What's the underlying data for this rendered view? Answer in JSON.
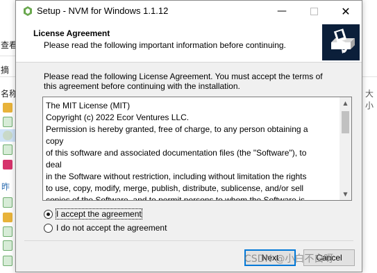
{
  "background": {
    "fragments": [
      "查看",
      "摘",
      "名称",
      "昨",
      "大小"
    ]
  },
  "window": {
    "title": "Setup - NVM for Windows 1.1.12",
    "minimize_glyph": "—",
    "close_glyph": "✕"
  },
  "header": {
    "title": "License Agreement",
    "subtitle": "Please read the following important information before continuing."
  },
  "intro": "Please read the following License Agreement. You must accept the terms of this agreement before continuing with the installation.",
  "license": {
    "lines": [
      "The MIT License (MIT)",
      "",
      "Copyright (c) 2022 Ecor Ventures LLC.",
      "",
      "Permission is hereby granted, free of charge, to any person obtaining a copy",
      "of this software and associated documentation files (the \"Software\"), to deal",
      "in the Software without restriction, including without limitation the rights",
      "to use, copy, modify, merge, publish, distribute, sublicense, and/or sell",
      "copies of the Software, and to permit persons to whom the Software is"
    ]
  },
  "options": {
    "accept": "I accept the agreement",
    "decline": "I do not accept the agreement",
    "selected": "accept"
  },
  "buttons": {
    "next": "Next",
    "cancel": "Cancel"
  },
  "watermark": "CSDN @小白不白呀",
  "colors": {
    "logo_bg": "#0b1f3a",
    "dialog_bg": "#f0f0f0",
    "focus_border": "#0078d7"
  }
}
